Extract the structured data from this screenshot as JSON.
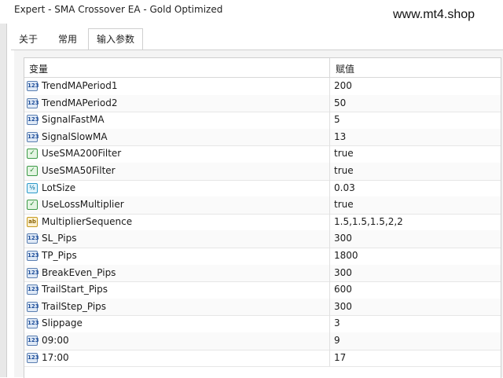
{
  "window": {
    "title": "Expert - SMA Crossover EA - Gold Optimized",
    "watermark": "www.mt4.shop"
  },
  "tabs": [
    {
      "label": "关于",
      "active": false
    },
    {
      "label": "常用",
      "active": false
    },
    {
      "label": "输入参数",
      "active": true
    }
  ],
  "table": {
    "columns": {
      "name": "变量",
      "value": "赋值"
    },
    "rows": [
      {
        "name": "TrendMAPeriod1",
        "value": "200",
        "type": "int",
        "icon": "int-icon",
        "badge": "123"
      },
      {
        "name": "TrendMAPeriod2",
        "value": "50",
        "type": "int",
        "icon": "int-icon",
        "badge": "123"
      },
      {
        "name": "SignalFastMA",
        "value": "5",
        "type": "int",
        "icon": "int-icon",
        "badge": "123"
      },
      {
        "name": "SignalSlowMA",
        "value": "13",
        "type": "int",
        "icon": "int-icon",
        "badge": "123"
      },
      {
        "name": "UseSMA200Filter",
        "value": "true",
        "type": "bool",
        "icon": "bool-icon",
        "badge": "✓"
      },
      {
        "name": "UseSMA50Filter",
        "value": "true",
        "type": "bool",
        "icon": "bool-icon",
        "badge": "✓"
      },
      {
        "name": "LotSize",
        "value": "0.03",
        "type": "double",
        "icon": "double-icon",
        "badge": "½"
      },
      {
        "name": "UseLossMultiplier",
        "value": "true",
        "type": "bool",
        "icon": "bool-icon",
        "badge": "✓"
      },
      {
        "name": "MultiplierSequence",
        "value": "1.5,1.5,1.5,2,2",
        "type": "string",
        "icon": "string-icon",
        "badge": "ab"
      },
      {
        "name": "SL_Pips",
        "value": "300",
        "type": "int",
        "icon": "int-icon",
        "badge": "123"
      },
      {
        "name": "TP_Pips",
        "value": "1800",
        "type": "int",
        "icon": "int-icon",
        "badge": "123"
      },
      {
        "name": "BreakEven_Pips",
        "value": "300",
        "type": "int",
        "icon": "int-icon",
        "badge": "123"
      },
      {
        "name": "TrailStart_Pips",
        "value": "600",
        "type": "int",
        "icon": "int-icon",
        "badge": "123"
      },
      {
        "name": "TrailStep_Pips",
        "value": "300",
        "type": "int",
        "icon": "int-icon",
        "badge": "123"
      },
      {
        "name": "Slippage",
        "value": "3",
        "type": "int",
        "icon": "int-icon",
        "badge": "123"
      },
      {
        "name": "09:00",
        "value": "9",
        "type": "int",
        "icon": "int-icon",
        "badge": "123"
      },
      {
        "name": "17:00",
        "value": "17",
        "type": "int",
        "icon": "int-icon",
        "badge": "123"
      }
    ]
  },
  "colors": {
    "int_icon": "#5b7fb1",
    "bool_icon": "#3c9a46",
    "double_icon": "#2e9ac9",
    "string_icon": "#c79a1e"
  }
}
